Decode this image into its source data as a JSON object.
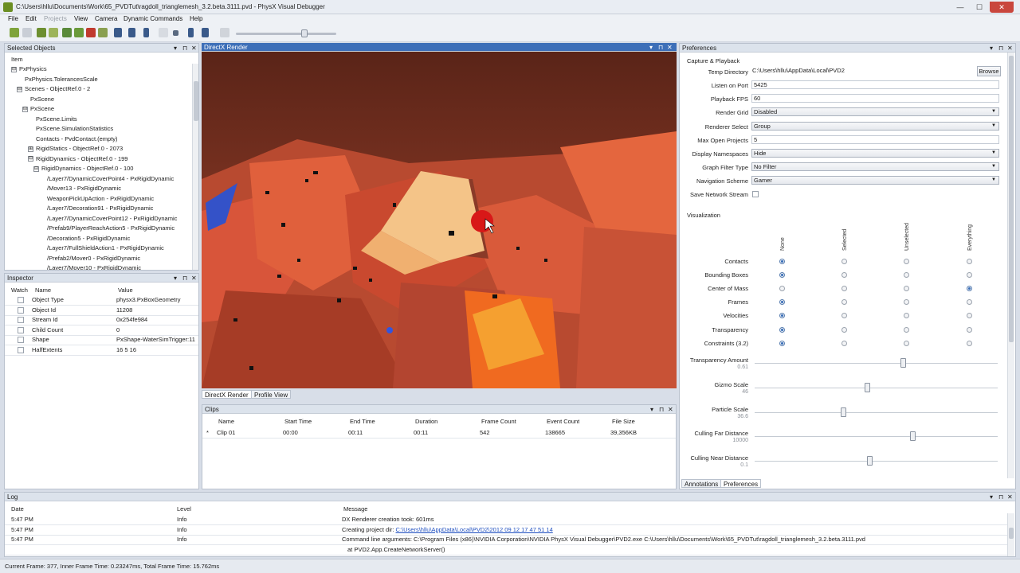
{
  "window": {
    "title": "C:\\Users\\hllu\\Documents\\Work\\65_PVDTut\\ragdoll_trianglemesh_3.2.beta.3111.pvd - PhysX Visual Debugger",
    "minimize": "—",
    "maximize": "☐",
    "close": "✕"
  },
  "menu": [
    "File",
    "Edit",
    "Projects",
    "View",
    "Camera",
    "Dynamic Commands",
    "Help"
  ],
  "toolbar": {
    "icons": [
      "connect-icon",
      "disconnect-icon",
      "open-icon",
      "save-icon",
      "add-icon",
      "add-all-icon",
      "remove-icon",
      "remove-all-icon",
      "first-frame-icon",
      "prev-frame-icon",
      "step-back-icon",
      "play-icon",
      "stop-icon",
      "step-forward-icon",
      "next-frame-icon",
      "last-frame-icon",
      "loop-icon"
    ]
  },
  "selected_objects": {
    "title": "Selected Objects",
    "column": "Item",
    "rows": [
      {
        "label": "PxPhysics",
        "indent": 0,
        "exp": "⊟"
      },
      {
        "label": "PxPhysics.TolerancesScale",
        "indent": 1,
        "exp": ""
      },
      {
        "label": "Scenes - ObjectRef.0 - 2",
        "indent": 1,
        "exp": "⊟"
      },
      {
        "label": "PxScene",
        "indent": 2,
        "exp": ""
      },
      {
        "label": "PxScene",
        "indent": 2,
        "exp": "⊟"
      },
      {
        "label": "PxScene.Limits",
        "indent": 3,
        "exp": ""
      },
      {
        "label": "PxScene.SimulationStatistics",
        "indent": 3,
        "exp": ""
      },
      {
        "label": "Contacts - PvdContact.(empty)",
        "indent": 3,
        "exp": ""
      },
      {
        "label": "RigidStatics - ObjectRef.0 - 2073",
        "indent": 3,
        "exp": "⊞"
      },
      {
        "label": "RigidDynamics - ObjectRef.0 - 199",
        "indent": 3,
        "exp": "⊟"
      },
      {
        "label": "RigidDynamics - ObjectRef.0 - 100",
        "indent": 4,
        "exp": "⊟"
      },
      {
        "label": "/Layer7/DynamicCoverPoint4 - PxRigidDynamic",
        "indent": 5,
        "exp": ""
      },
      {
        "label": "/Mover13 - PxRigidDynamic",
        "indent": 5,
        "exp": ""
      },
      {
        "label": "WeaponPickUpAction - PxRigidDynamic",
        "indent": 5,
        "exp": ""
      },
      {
        "label": "/Layer7/Decoration91 - PxRigidDynamic",
        "indent": 5,
        "exp": ""
      },
      {
        "label": "/Layer7/DynamicCoverPoint12 - PxRigidDynamic",
        "indent": 5,
        "exp": ""
      },
      {
        "label": "/Prefab9/PlayerReachAction5 - PxRigidDynamic",
        "indent": 5,
        "exp": ""
      },
      {
        "label": "/Decoration5 - PxRigidDynamic",
        "indent": 5,
        "exp": ""
      },
      {
        "label": "/Layer7/FullShieldAction1 - PxRigidDynamic",
        "indent": 5,
        "exp": ""
      },
      {
        "label": "/Prefab2/Mover0 - PxRigidDynamic",
        "indent": 5,
        "exp": ""
      },
      {
        "label": "/Layer7/Mover10 - PxRigidDynamic",
        "indent": 5,
        "exp": ""
      }
    ]
  },
  "inspector": {
    "title": "Inspector",
    "columns": [
      "Watch",
      "Name",
      "Value"
    ],
    "rows": [
      {
        "name": "Object Type",
        "value": "physx3.PxBoxGeometry"
      },
      {
        "name": "Object Id",
        "value": "11208"
      },
      {
        "name": "Stream Id",
        "value": "0x254fe984"
      },
      {
        "name": "Child Count",
        "value": "0"
      },
      {
        "name": "Shape",
        "value": "PxShape-WaterSimTrigger:11"
      },
      {
        "name": "HalfExtents",
        "value": "16 5 16"
      }
    ]
  },
  "render": {
    "title": "DirectX Render",
    "tabs": [
      "DirectX Render",
      "Profile View"
    ]
  },
  "clips": {
    "title": "Clips",
    "columns": [
      "Name",
      "Start Time",
      "End Time",
      "Duration",
      "Frame Count",
      "Event Count",
      "File Size"
    ],
    "rows": [
      {
        "marker": "*",
        "name": "Clip 01",
        "start": "00:00",
        "end": "00:11",
        "duration": "00:11",
        "frames": "542",
        "events": "138665",
        "size": "39,356KB"
      }
    ]
  },
  "preferences": {
    "title": "Preferences",
    "section1": "Capture & Playback",
    "temp_dir_label": "Temp Directory",
    "temp_dir_value": "C:\\Users\\hllu\\AppData\\Local\\PVD2",
    "browse": "Browse",
    "fields": [
      {
        "label": "Listen on Port",
        "value": "5425",
        "kind": "text"
      },
      {
        "label": "Playback FPS",
        "value": "60",
        "kind": "text"
      },
      {
        "label": "Render Grid",
        "value": "Disabled",
        "kind": "select"
      },
      {
        "label": "Renderer Select",
        "value": "Group",
        "kind": "select"
      },
      {
        "label": "Max Open Projects",
        "value": "5",
        "kind": "text"
      },
      {
        "label": "Display Namespaces",
        "value": "Hide",
        "kind": "select"
      },
      {
        "label": "Graph Filter Type",
        "value": "No Filter",
        "kind": "select"
      },
      {
        "label": "Navigation Scheme",
        "value": "Gamer",
        "kind": "select"
      }
    ],
    "save_stream_label": "Save Network Stream",
    "section2": "Visualization",
    "vis_columns": [
      "None",
      "Selected",
      "Unselected",
      "Everything"
    ],
    "vis_rows": [
      {
        "label": "Contacts",
        "selected": 0
      },
      {
        "label": "Bounding Boxes",
        "selected": 0
      },
      {
        "label": "Center of Mass",
        "selected": 3
      },
      {
        "label": "Frames",
        "selected": 0
      },
      {
        "label": "Velocities",
        "selected": 0
      },
      {
        "label": "Transparency",
        "selected": 0
      },
      {
        "label": "Constraints (3.2)",
        "selected": 0
      }
    ],
    "sliders": [
      {
        "label": "Transparency Amount",
        "value": "0.61",
        "pos": 0.61
      },
      {
        "label": "Gizmo Scale",
        "value": "46",
        "pos": 0.46
      },
      {
        "label": "Particle Scale",
        "value": "36.6",
        "pos": 0.36
      },
      {
        "label": "Culling Far Distance",
        "value": "10000",
        "pos": 0.65
      },
      {
        "label": "Culling Near Distance",
        "value": "0.1",
        "pos": 0.47
      }
    ],
    "tabs": [
      "Annotations",
      "Preferences"
    ]
  },
  "log": {
    "title": "Log",
    "columns": [
      "Date",
      "Level",
      "Message"
    ],
    "rows": [
      {
        "date": "5:47 PM",
        "level": "Info",
        "message": "DX Renderer creation took: 601ms",
        "link": ""
      },
      {
        "date": "5:47 PM",
        "level": "Info",
        "message": "Creating project dir: ",
        "link": "C:\\Users\\hllu\\AppData\\Local\\PVD2\\2012 09 12 17 47 51 14"
      },
      {
        "date": "5:47 PM",
        "level": "Info",
        "message": "Command line arguments: C:\\Program Files (x86)\\NVIDIA Corporation\\NVIDIA PhysX Visual Debugger\\PVD2.exe C:\\Users\\hllu\\Documents\\Work\\65_PVDTut\\ragdoll_trianglemesh_3.2.beta.3111.pvd",
        "link": ""
      },
      {
        "date": "",
        "level": "",
        "message": "at PVD2.App.CreateNetworkServer()",
        "link": ""
      }
    ]
  },
  "status": "Current Frame: 377, Inner Frame Time: 0.23247ms, Total Frame Time: 15.762ms",
  "colors": {
    "accent": "#3d6fb8",
    "render_bg": "#7a3322",
    "highlight": "#f3c98a"
  }
}
